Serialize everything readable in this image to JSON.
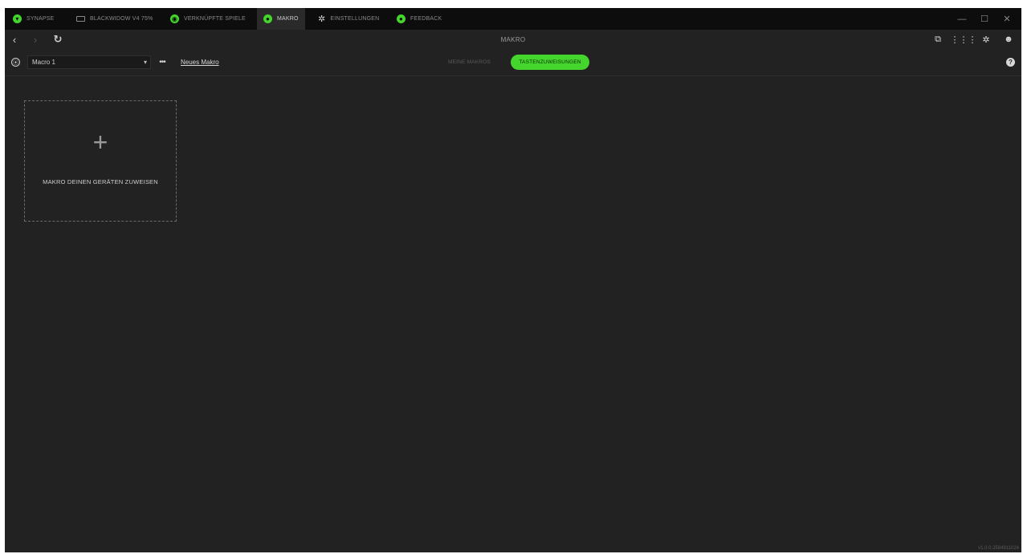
{
  "tabs": [
    {
      "label": "SYNAPSE",
      "icon": "synapse-icon"
    },
    {
      "label": "BLACKWIDOW V4 75%",
      "icon": "keyboard-icon"
    },
    {
      "label": "VERKNÜPFTE SPIELE",
      "icon": "gamepad-icon"
    },
    {
      "label": "MAKRO",
      "icon": "macro-icon",
      "active": true
    },
    {
      "label": "EINSTELLUNGEN",
      "icon": "gear-icon"
    },
    {
      "label": "FEEDBACK",
      "icon": "feedback-icon"
    }
  ],
  "window_controls": {
    "minimize": "—",
    "maximize": "☐",
    "close": "✕"
  },
  "nav": {
    "back": "‹",
    "forward": "›",
    "refresh": "↻",
    "title": "MAKRO"
  },
  "toolbar": {
    "selected_macro": "Macro 1",
    "more": "•••",
    "new_macro": "Neues Makro",
    "segment_inactive": "MEINE MAKROS",
    "segment_active": "TASTENZUWEISUNGEN"
  },
  "main": {
    "plus": "+",
    "assign_label": "MAKRO DEINEN GERÄTEN ZUWEISEN"
  },
  "version": "v1.0.0.2584911024",
  "colors": {
    "accent": "#44d62c",
    "background": "#222222",
    "titlebar": "#0d0d0d"
  }
}
